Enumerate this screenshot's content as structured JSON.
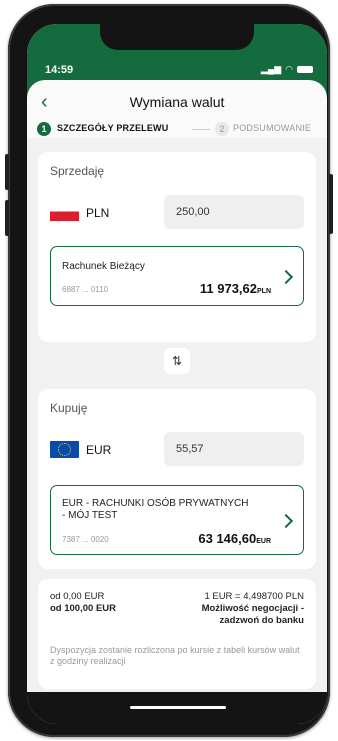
{
  "status": {
    "time": "14:59",
    "signal_icon": "signal-icon",
    "wifi_icon": "wifi-icon",
    "battery_icon": "battery-icon"
  },
  "header": {
    "back_icon": "chevron-left-icon",
    "title": "Wymiana walut"
  },
  "steps": [
    {
      "number": "1",
      "label": "SZCZEGÓŁY PRZELEWU",
      "active": true
    },
    {
      "number": "2",
      "label": "PODSUMOWANIE",
      "active": false
    }
  ],
  "sell": {
    "label": "Sprzedaję",
    "currency": "PLN",
    "amount": "250,00",
    "account": {
      "name": "Rachunek Bieżący",
      "number": "6887 ... 0110",
      "balance": "11 973,62",
      "balance_currency": "PLN"
    }
  },
  "swap_icon": "swap-arrows-icon",
  "swap_glyph": "⇅",
  "buy": {
    "label": "Kupuję",
    "currency": "EUR",
    "amount": "55,57",
    "account": {
      "name_line1": "EUR - RACHUNKI OSÓB PRYWATNYCH",
      "name_line2": "- MÓJ TEST",
      "number": "7387 ... 0020",
      "balance": "63 146,60",
      "balance_currency": "EUR"
    }
  },
  "info": {
    "range_from": "od 0,00 EUR",
    "range_to": "od 100,00 EUR",
    "rate": "1 EUR = 4,498700 PLN",
    "negotiation_line1": "Możliwość negocjacji -",
    "negotiation_line2": "zadzwoń do banku",
    "note": "Dyspozycja zostanie rozliczona po kursie z tabeli kursów walut z godziny realizacji"
  },
  "colors": {
    "brand": "#136b3e",
    "background": "#f1f1f1"
  }
}
